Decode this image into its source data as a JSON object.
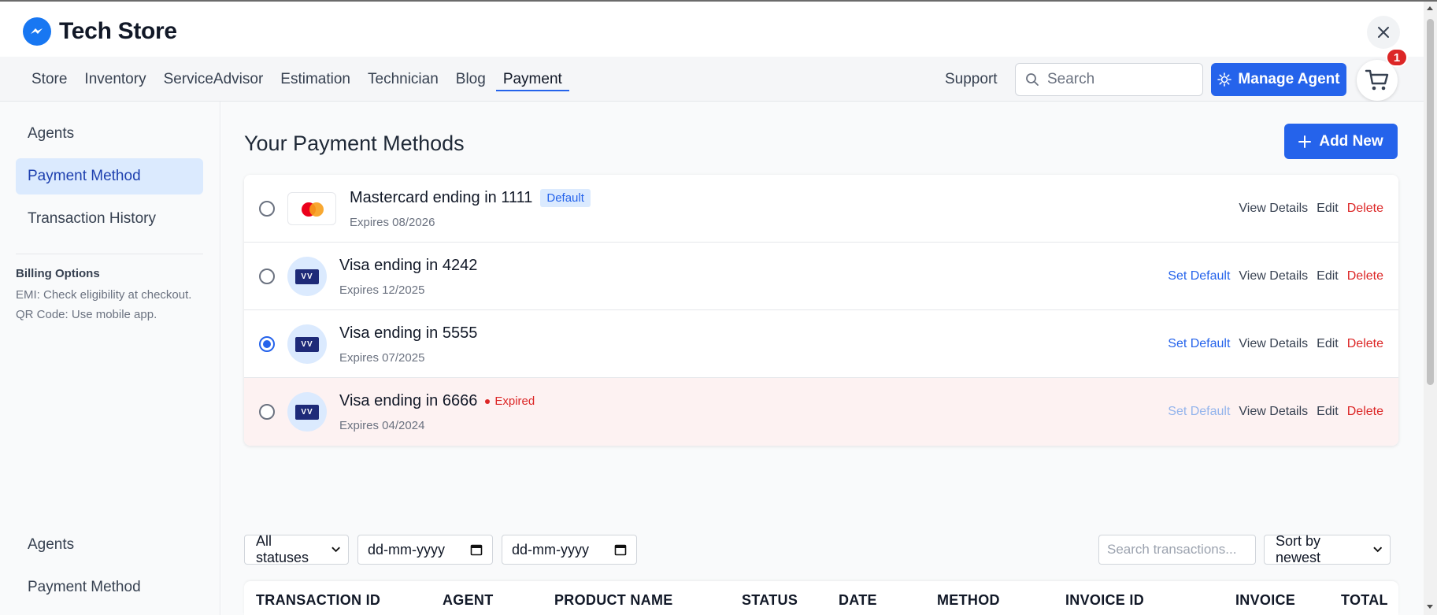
{
  "header": {
    "brand_name": "Tech Store",
    "cart_count": "1"
  },
  "nav": {
    "links": [
      "Store",
      "Inventory",
      "ServiceAdvisor",
      "Estimation",
      "Technician",
      "Blog",
      "Payment"
    ],
    "active": "Payment",
    "support_label": "Support",
    "search_placeholder": "Search",
    "manage_agent_label": "Manage Agent"
  },
  "sidebar": {
    "top_items": [
      "Agents",
      "Payment Method",
      "Transaction History"
    ],
    "active": "Payment Method",
    "billing_title": "Billing Options",
    "billing_lines": [
      "EMI: Check eligibility at checkout.",
      "QR Code: Use mobile app."
    ],
    "bottom_items": [
      "Agents",
      "Payment Method"
    ]
  },
  "main": {
    "title": "Your Payment Methods",
    "add_new_label": "Add New"
  },
  "cards": [
    {
      "brand": "mastercard",
      "name": "Mastercard ending in 1111",
      "expires": "Expires 08/2026",
      "badge": "Default",
      "badge_type": "default",
      "selected": false,
      "set_default": "",
      "view_details": "View Details",
      "edit": "Edit",
      "delete": "Delete"
    },
    {
      "brand": "visa",
      "name": "Visa ending in 4242",
      "expires": "Expires 12/2025",
      "badge": "",
      "badge_type": "",
      "selected": false,
      "set_default": "Set Default",
      "view_details": "View Details",
      "edit": "Edit",
      "delete": "Delete"
    },
    {
      "brand": "visa",
      "name": "Visa ending in 5555",
      "expires": "Expires 07/2025",
      "badge": "",
      "badge_type": "",
      "selected": true,
      "set_default": "Set Default",
      "view_details": "View Details",
      "edit": "Edit",
      "delete": "Delete"
    },
    {
      "brand": "visa",
      "name": "Visa ending in 6666",
      "expires": "Expires 04/2024",
      "badge": "Expired",
      "badge_type": "expired",
      "selected": false,
      "set_default": "Set Default",
      "view_details": "View Details",
      "edit": "Edit",
      "delete": "Delete"
    }
  ],
  "visa_logo_text": "VV",
  "filters": {
    "status_value": "All statuses",
    "date_from_placeholder": "dd-mm-yyyy",
    "date_to_placeholder": "dd-mm-yyyy",
    "search_placeholder": "Search transactions...",
    "sort_value": "Sort by newest"
  },
  "table": {
    "headers": [
      "TRANSACTION ID",
      "AGENT",
      "PRODUCT NAME",
      "STATUS",
      "DATE",
      "METHOD",
      "INVOICE ID",
      "INVOICE",
      "TOTAL"
    ]
  },
  "colors": {
    "accent": "#2563eb",
    "danger": "#dc2626",
    "active_bg": "#dbeafe"
  }
}
